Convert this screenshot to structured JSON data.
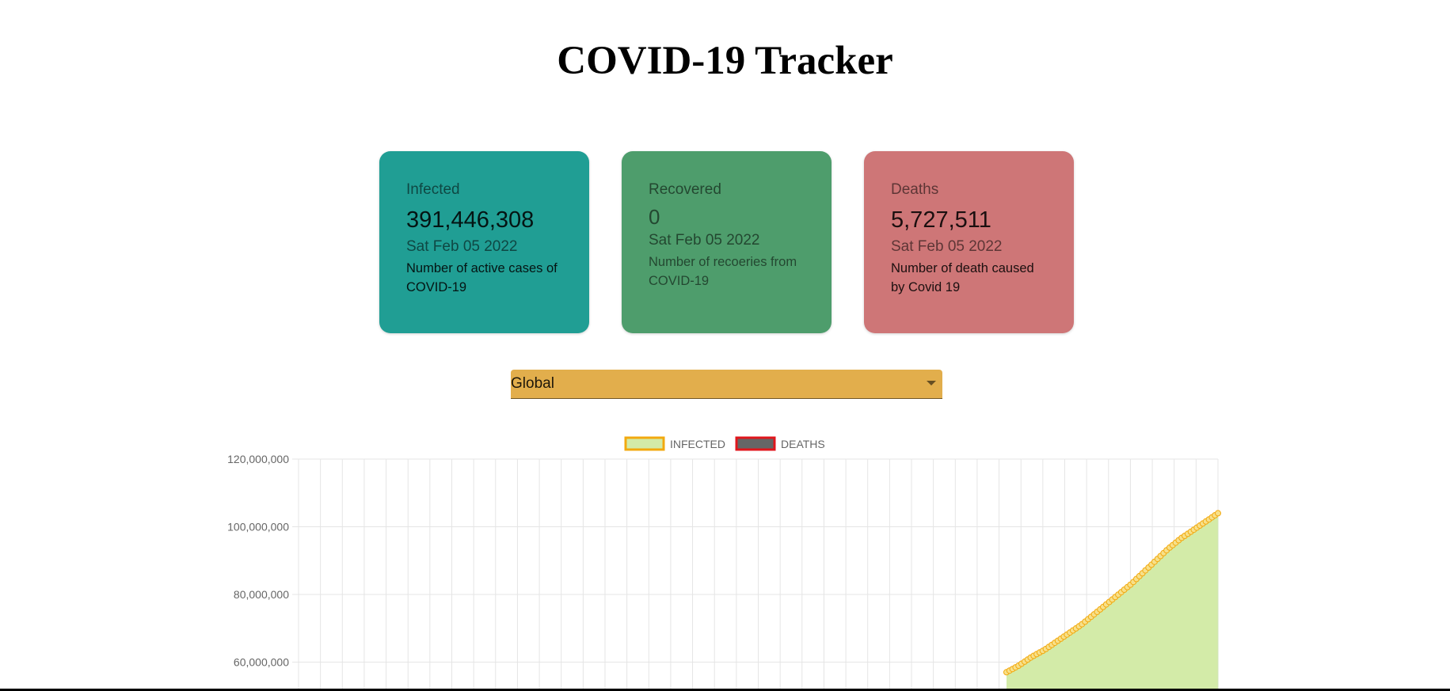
{
  "header": {
    "title": "COVID-19 Tracker"
  },
  "cards": {
    "infected": {
      "label": "Infected",
      "value": "391,446,308",
      "date": "Sat Feb 05 2022",
      "description": "Number of active cases of COVID-19",
      "color": "#209e94"
    },
    "recovered": {
      "label": "Recovered",
      "value": "0",
      "date": "Sat Feb 05 2022",
      "description": "Number of recoeries from COVID-19",
      "color": "#4e9d6c"
    },
    "deaths": {
      "label": "Deaths",
      "value": "5,727,511",
      "date": "Sat Feb 05 2022",
      "description": "Number of death caused by Covid 19",
      "color": "#ce7677"
    }
  },
  "country_select": {
    "selected": "Global",
    "color": "#e2ae4c"
  },
  "chart_data": {
    "type": "area",
    "legend": {
      "position": "top",
      "items": [
        {
          "name": "INFECTED",
          "fill": "#d3eba8",
          "border": "#f2a90f"
        },
        {
          "name": "DEATHS",
          "fill": "#666666",
          "border": "#e0161c"
        }
      ]
    },
    "y_ticks": [
      "120,000,000",
      "100,000,000",
      "80,000,000",
      "60,000,000"
    ],
    "ylim": [
      60000000,
      120000000
    ],
    "grid": true,
    "series": [
      {
        "name": "INFECTED",
        "line_color": "#f2a90f",
        "fill_color": "#d3eba8",
        "segment_x_range": [
          0.77,
          1.0
        ],
        "values": [
          57000000,
          59000000,
          61500000,
          63500000,
          66000000,
          68500000,
          71000000,
          74000000,
          77000000,
          80000000,
          83000000,
          86500000,
          90000000,
          93500000,
          96500000,
          99000000,
          101500000,
          104000000
        ]
      }
    ]
  }
}
